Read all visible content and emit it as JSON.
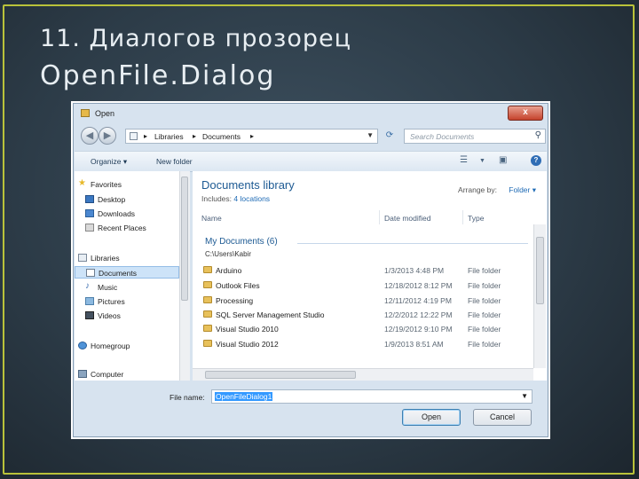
{
  "slide": {
    "title_line1": "11. Диалогов прозорец",
    "title_line2": "OpenFile.Dialog"
  },
  "dialog": {
    "title": "Open",
    "close_glyph": "x",
    "address": {
      "crumbs": [
        "Libraries",
        "Documents"
      ]
    },
    "search_placeholder": "Search Documents",
    "toolbar": {
      "organize": "Organize ▾",
      "new_folder": "New folder"
    },
    "nav": {
      "favorites": "Favorites",
      "desktop": "Desktop",
      "downloads": "Downloads",
      "recent": "Recent Places",
      "libraries": "Libraries",
      "documents": "Documents",
      "music": "Music",
      "pictures": "Pictures",
      "videos": "Videos",
      "homegroup": "Homegroup",
      "computer": "Computer"
    },
    "library": {
      "title": "Documents library",
      "includes_label": "Includes:",
      "includes_value": "4 locations",
      "arrange_label": "Arrange by:",
      "arrange_value": "Folder ▾"
    },
    "columns": {
      "name": "Name",
      "date": "Date modified",
      "type": "Type"
    },
    "group": {
      "header": "My Documents (6)",
      "path": "C:\\Users\\Kabir"
    },
    "files": [
      {
        "name": "Arduino",
        "date": "1/3/2013 4:48 PM",
        "type": "File folder"
      },
      {
        "name": "Outlook Files",
        "date": "12/18/2012 8:12 PM",
        "type": "File folder"
      },
      {
        "name": "Processing",
        "date": "12/11/2012 4:19 PM",
        "type": "File folder"
      },
      {
        "name": "SQL Server Management Studio",
        "date": "12/2/2012 12:22 PM",
        "type": "File folder"
      },
      {
        "name": "Visual Studio 2010",
        "date": "12/19/2012 9:10 PM",
        "type": "File folder"
      },
      {
        "name": "Visual Studio 2012",
        "date": "1/9/2013 8:51 AM",
        "type": "File folder"
      }
    ],
    "filename_label": "File name:",
    "filename_value": "OpenFileDialog1",
    "open_button": "Open",
    "cancel_button": "Cancel"
  }
}
